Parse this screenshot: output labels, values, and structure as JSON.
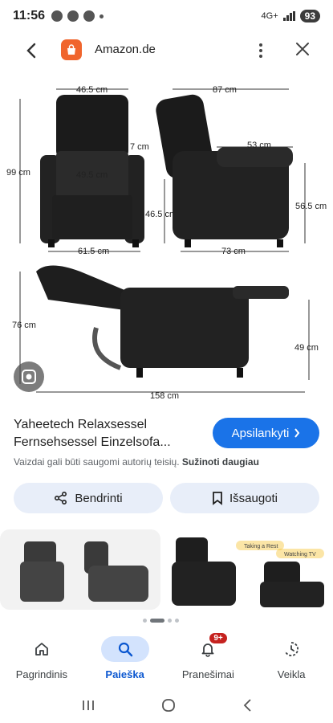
{
  "status_bar": {
    "time": "11:56",
    "network": "4G+",
    "battery": "93"
  },
  "top_bar": {
    "site_title": "Amazon.de"
  },
  "image": {
    "dimensions": {
      "top_width": "46.5 cm",
      "side_depth": "87 cm",
      "height": "99 cm",
      "armrest": "7 cm",
      "seat_width": "49.5 cm",
      "seat_depth": "53 cm",
      "seat_height": "46.5 cm",
      "arm_height": "56.5 cm",
      "base_width": "61.5 cm",
      "base_depth": "73 cm",
      "reclined_height": "76 cm",
      "footrest_height": "49 cm",
      "reclined_length": "158 cm"
    }
  },
  "product": {
    "title": "Yaheetech Relaxsessel Fernsehsessel Einzelsofa...",
    "visit_label": "Apsilankyti",
    "copyright_text": "Vaizdai gali būti saugomi autorių teisių.",
    "learn_more": "Sužinoti daugiau"
  },
  "actions": {
    "share_label": "Bendrinti",
    "save_label": "Išsaugoti"
  },
  "thumbnails": {
    "thumb2_tag1": "Taking a Rest",
    "thumb2_tag2": "Watching TV"
  },
  "bottom_nav": [
    {
      "label": "Pagrindinis",
      "icon": "home-icon"
    },
    {
      "label": "Paieška",
      "icon": "search-icon",
      "active": true
    },
    {
      "label": "Pranešimai",
      "icon": "bell-icon",
      "badge": "9+"
    },
    {
      "label": "Veikla",
      "icon": "activity-icon"
    }
  ],
  "colors": {
    "accent": "#1a73e8",
    "chip_bg": "#e8eef9",
    "nav_active_bg": "#d3e3fd",
    "badge": "#c5221f",
    "site_icon": "#f0652d"
  }
}
